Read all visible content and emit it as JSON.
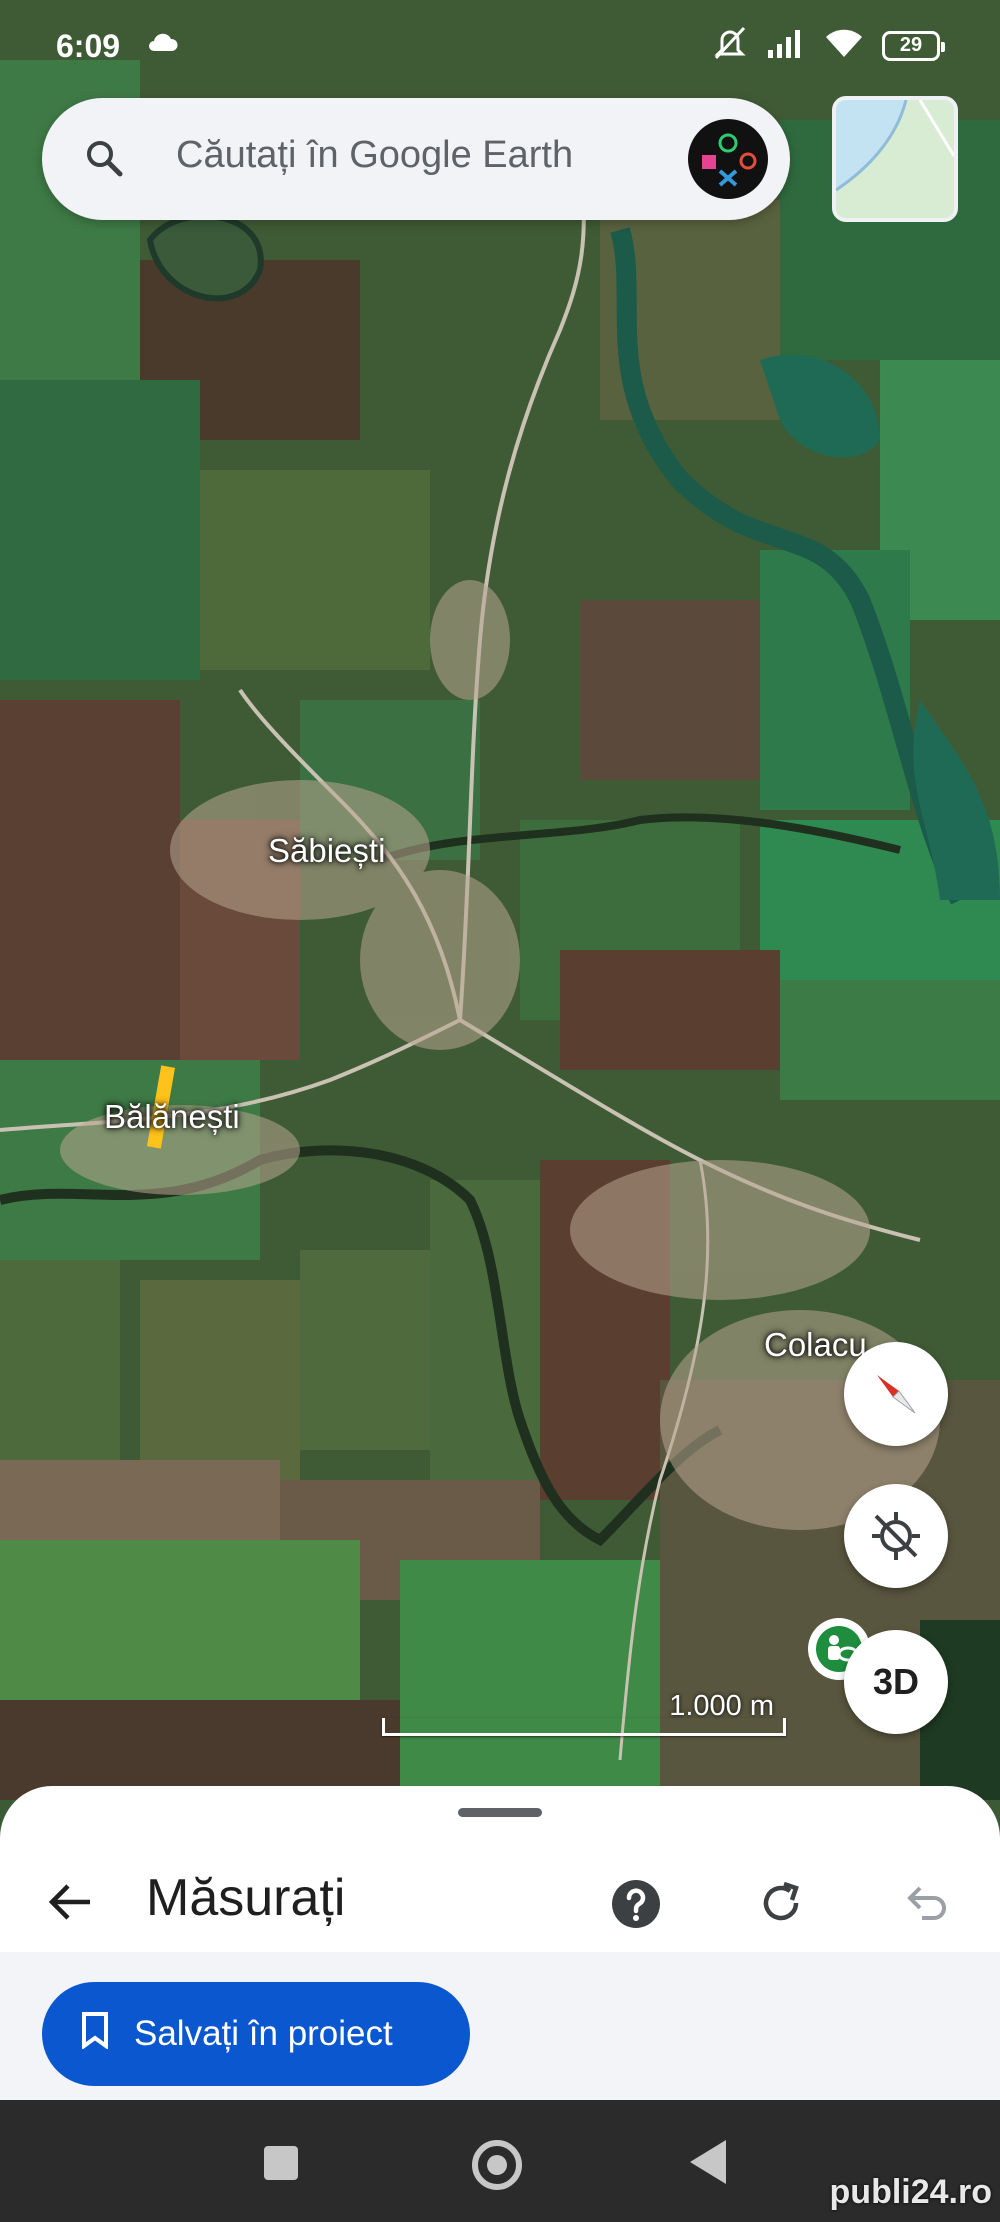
{
  "status_bar": {
    "time": "6:09",
    "battery": "29"
  },
  "search": {
    "placeholder": "Căutați în Google Earth"
  },
  "map": {
    "place_labels": [
      "Săbiești",
      "Bălănești",
      "Colacu"
    ],
    "scale_label": "1.000 m"
  },
  "controls": {
    "three_d_label": "3D"
  },
  "measure_panel": {
    "title": "Măsurați",
    "save_button_label": "Salvați în proiect"
  },
  "watermark": "publi24.ro",
  "colors": {
    "accent": "#0b57d0",
    "sheet_bg": "#ffffff",
    "nav_bg": "#2b2b2b"
  }
}
